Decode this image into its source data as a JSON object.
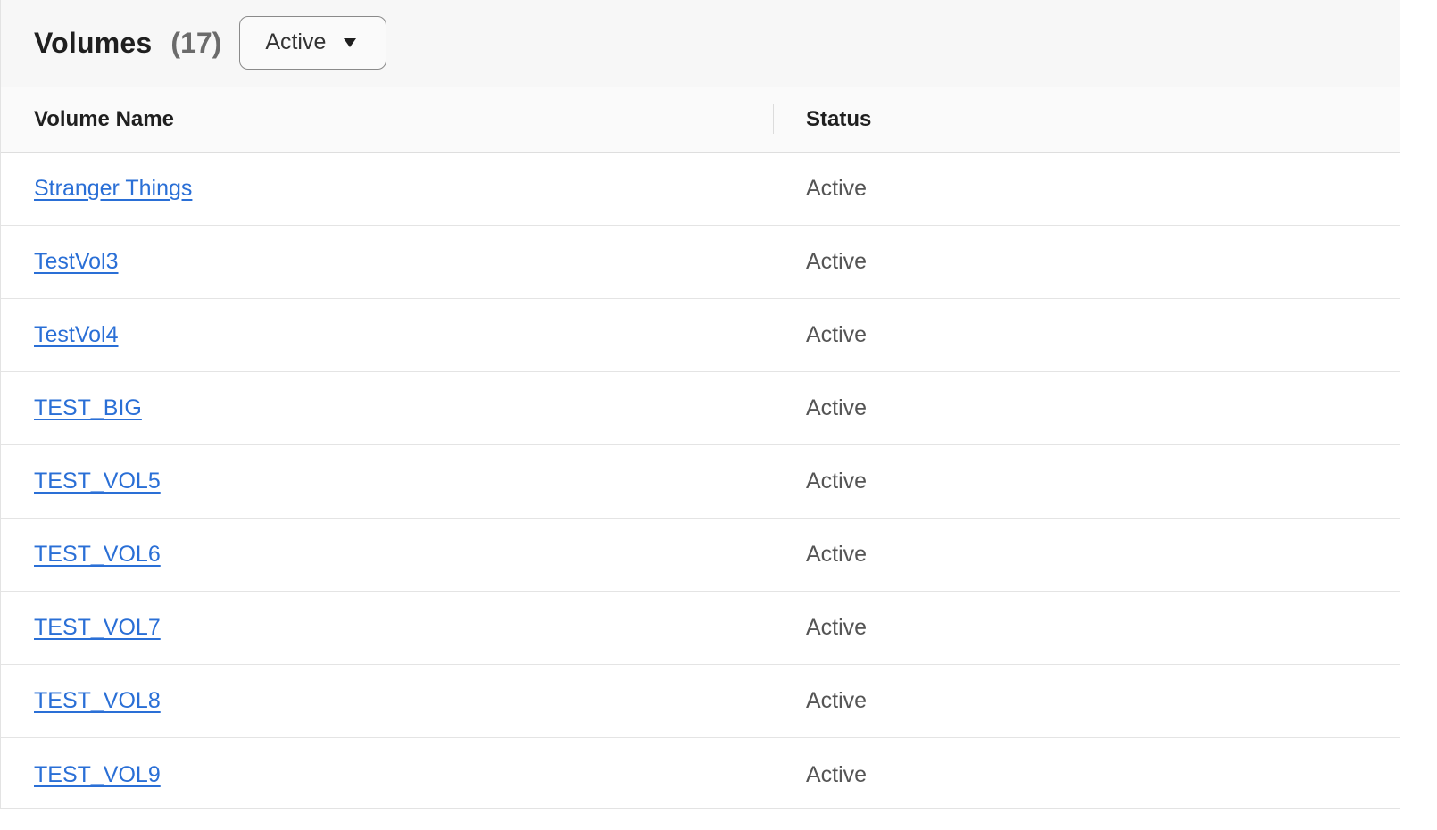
{
  "header": {
    "title": "Volumes",
    "count": "(17)",
    "filter": {
      "selected": "Active",
      "icon": "caret-down-icon"
    }
  },
  "table": {
    "columns": [
      "Volume Name",
      "Status"
    ],
    "rows": [
      {
        "name": "Stranger Things",
        "status": "Active"
      },
      {
        "name": "TestVol3",
        "status": "Active"
      },
      {
        "name": "TestVol4",
        "status": "Active"
      },
      {
        "name": "TEST_BIG",
        "status": "Active"
      },
      {
        "name": "TEST_VOL5",
        "status": "Active"
      },
      {
        "name": "TEST_VOL6",
        "status": "Active"
      },
      {
        "name": "TEST_VOL7",
        "status": "Active"
      },
      {
        "name": "TEST_VOL8",
        "status": "Active"
      },
      {
        "name": "TEST_VOL9",
        "status": "Active"
      }
    ]
  },
  "colors": {
    "link": "#2a6fd6",
    "header_bg": "#f7f7f7",
    "border": "#dedede"
  }
}
